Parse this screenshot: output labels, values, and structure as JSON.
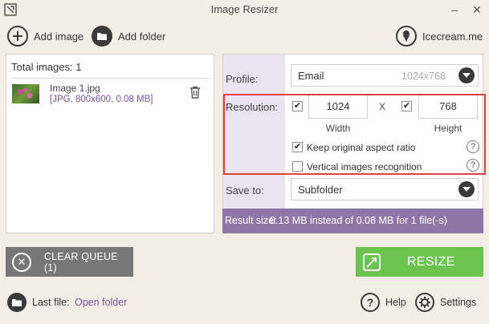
{
  "window": {
    "title": "Image Resizer",
    "minimize": "–",
    "close": "✕"
  },
  "toolbar": {
    "add_image": "Add image",
    "add_folder": "Add folder",
    "site": "Icecream.me"
  },
  "queue": {
    "total_label": "Total images: 1",
    "files": [
      {
        "name": "Image 1.jpg",
        "info": "[JPG, 800x600, 0.08 MB]"
      }
    ]
  },
  "settings": {
    "profile_label": "Profile:",
    "profile_value": "Email",
    "profile_dims": "1024x768",
    "resolution_label": "Resolution:",
    "width_value": "1024",
    "width_label": "Width",
    "x_sep": "X",
    "height_value": "768",
    "height_label": "Height",
    "keep_aspect_label": "Keep original aspect ratio",
    "keep_aspect_checked": true,
    "vertical_label": "Vertical images recognition",
    "vertical_checked": false,
    "save_label": "Save to:",
    "save_value": "Subfolder",
    "help_mark": "?"
  },
  "result": {
    "label": "Result size:",
    "text": "0.13 MB instead of 0.08 MB for 1 file(-s)"
  },
  "buttons": {
    "clear_queue": "CLEAR QUEUE (1)",
    "resize": "RESIZE"
  },
  "footer": {
    "last_file_label": "Last file:",
    "open_folder": "Open folder",
    "help": "Help",
    "settings": "Settings"
  },
  "colors": {
    "accent_purple": "#8e77a6",
    "resize_green": "#6cc34d",
    "highlight_red": "#e0403e",
    "clear_gray": "#777777"
  }
}
